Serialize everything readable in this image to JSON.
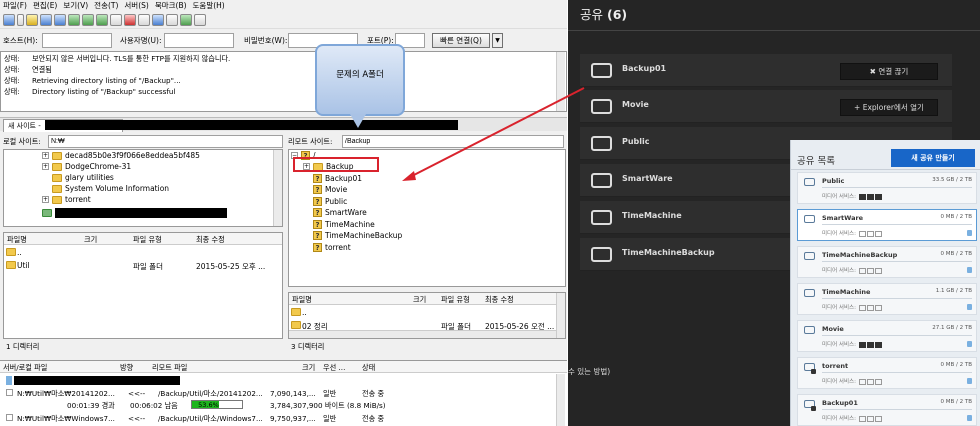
{
  "menu": [
    "파일(F)",
    "편집(E)",
    "보기(V)",
    "전송(T)",
    "서버(S)",
    "북마크(B)",
    "도움말(H)"
  ],
  "quick": {
    "host": "호스트(H):",
    "user": "사용자명(U):",
    "pass": "비밀번호(W):",
    "port": "포트(P):",
    "connect": "빠른 연결(Q)"
  },
  "log": [
    {
      "k": "상태:",
      "v": "보안되지 않은 서버입니다. TLS를 통한 FTP를 지원하지 않습니다."
    },
    {
      "k": "상태:",
      "v": "연결됨"
    },
    {
      "k": "상태:",
      "v": "Retrieving directory listing of \"/Backup\"..."
    },
    {
      "k": "상태:",
      "v": "Directory listing of \"/Backup\" successful"
    }
  ],
  "tab": "새 사이트 -",
  "local": {
    "label": "로컬 사이트:",
    "path": "N:₩",
    "tree": [
      "decad85b0e3f9f066e8eddea5bf485",
      "DodgeChrome-31",
      "glary utilities",
      "System Volume Information",
      "torrent"
    ],
    "headers": [
      "파일명",
      "크기",
      "파일 유형",
      "최종 수정"
    ],
    "rows": [
      {
        "name": "..",
        "type": "",
        "date": ""
      },
      {
        "name": "Util",
        "type": "파일 폴더",
        "date": "2015-05-25 오후 ..."
      }
    ],
    "status": "1 디렉터리"
  },
  "remote": {
    "label": "리모트 사이트:",
    "path": "/Backup",
    "root": "/",
    "tree": [
      "Backup",
      "Backup01",
      "Movie",
      "Public",
      "SmartWare",
      "TimeMachine",
      "TimeMachineBackup",
      "torrent"
    ],
    "headers": [
      "파일명",
      "크기",
      "파일 유형",
      "최종 수정"
    ],
    "rows": [
      {
        "name": "..",
        "type": "",
        "date": ""
      },
      {
        "name": "02 정리",
        "type": "파일 폴더",
        "date": "2015-05-26 오전 ..."
      }
    ],
    "status": "3 디렉터리"
  },
  "callout": "문제의 A폴더",
  "queue": {
    "headers": [
      "서버/로컬 파일",
      "방향",
      "리모트 파일",
      "크기",
      "우선 ...",
      "상태"
    ],
    "rows": [
      {
        "local": "N:₩Util₩마소₩20141202...",
        "dir": "<<--",
        "remote": "/Backup/Util/마소/20141202...",
        "size": "7,090,143,...",
        "prio": "일반",
        "state": "전송 중"
      },
      {
        "local": "N:₩Util₩마소₩Windows7...",
        "dir": "<<--",
        "remote": "/Backup/Util/마소/Windows7...",
        "size": "9,750,937,...",
        "prio": "일반",
        "state": "전송 중"
      }
    ],
    "progress": {
      "elapsed": "00:01:39 경과",
      "remaining": "00:06:02 남음",
      "percent": "53.6%",
      "fraction": 0.536,
      "bytes": "3,784,307,900 바이트 (8.8 MiB/s)"
    }
  },
  "dark": {
    "title_prefix": "공유 ",
    "title_count": "(6)",
    "shares": [
      {
        "name": "Backup01",
        "btn": "✖  연결 끊기"
      },
      {
        "name": "Movie",
        "btn": "+  Explorer에서 열기"
      },
      {
        "name": "Public",
        "btn": ""
      },
      {
        "name": "SmartWare",
        "btn": ""
      },
      {
        "name": "TimeMachine",
        "btn": ""
      },
      {
        "name": "TimeMachineBackup",
        "btn": ""
      }
    ],
    "instr": "수 있는 방법)"
  },
  "panel": {
    "title": "공유 목록",
    "new_btn": "새 공유 만들기",
    "media_label": "미디어 서비스:",
    "items": [
      {
        "name": "Public",
        "size": "33.5 GB / 2 TB"
      },
      {
        "name": "SmartWare",
        "size": "0 MB / 2 TB"
      },
      {
        "name": "TimeMachineBackup",
        "size": "0 MB / 2 TB"
      },
      {
        "name": "TimeMachine",
        "size": "1.1 GB / 2 TB"
      },
      {
        "name": "Movie",
        "size": "27.1 GB / 2 TB"
      },
      {
        "name": "torrent",
        "size": "0 MB / 2 TB"
      },
      {
        "name": "Backup01",
        "size": "0 MB / 2 TB"
      }
    ]
  },
  "colors": {
    "accent": "#1866c8",
    "highlight": "#d9232d",
    "progress": "#1db51d"
  }
}
